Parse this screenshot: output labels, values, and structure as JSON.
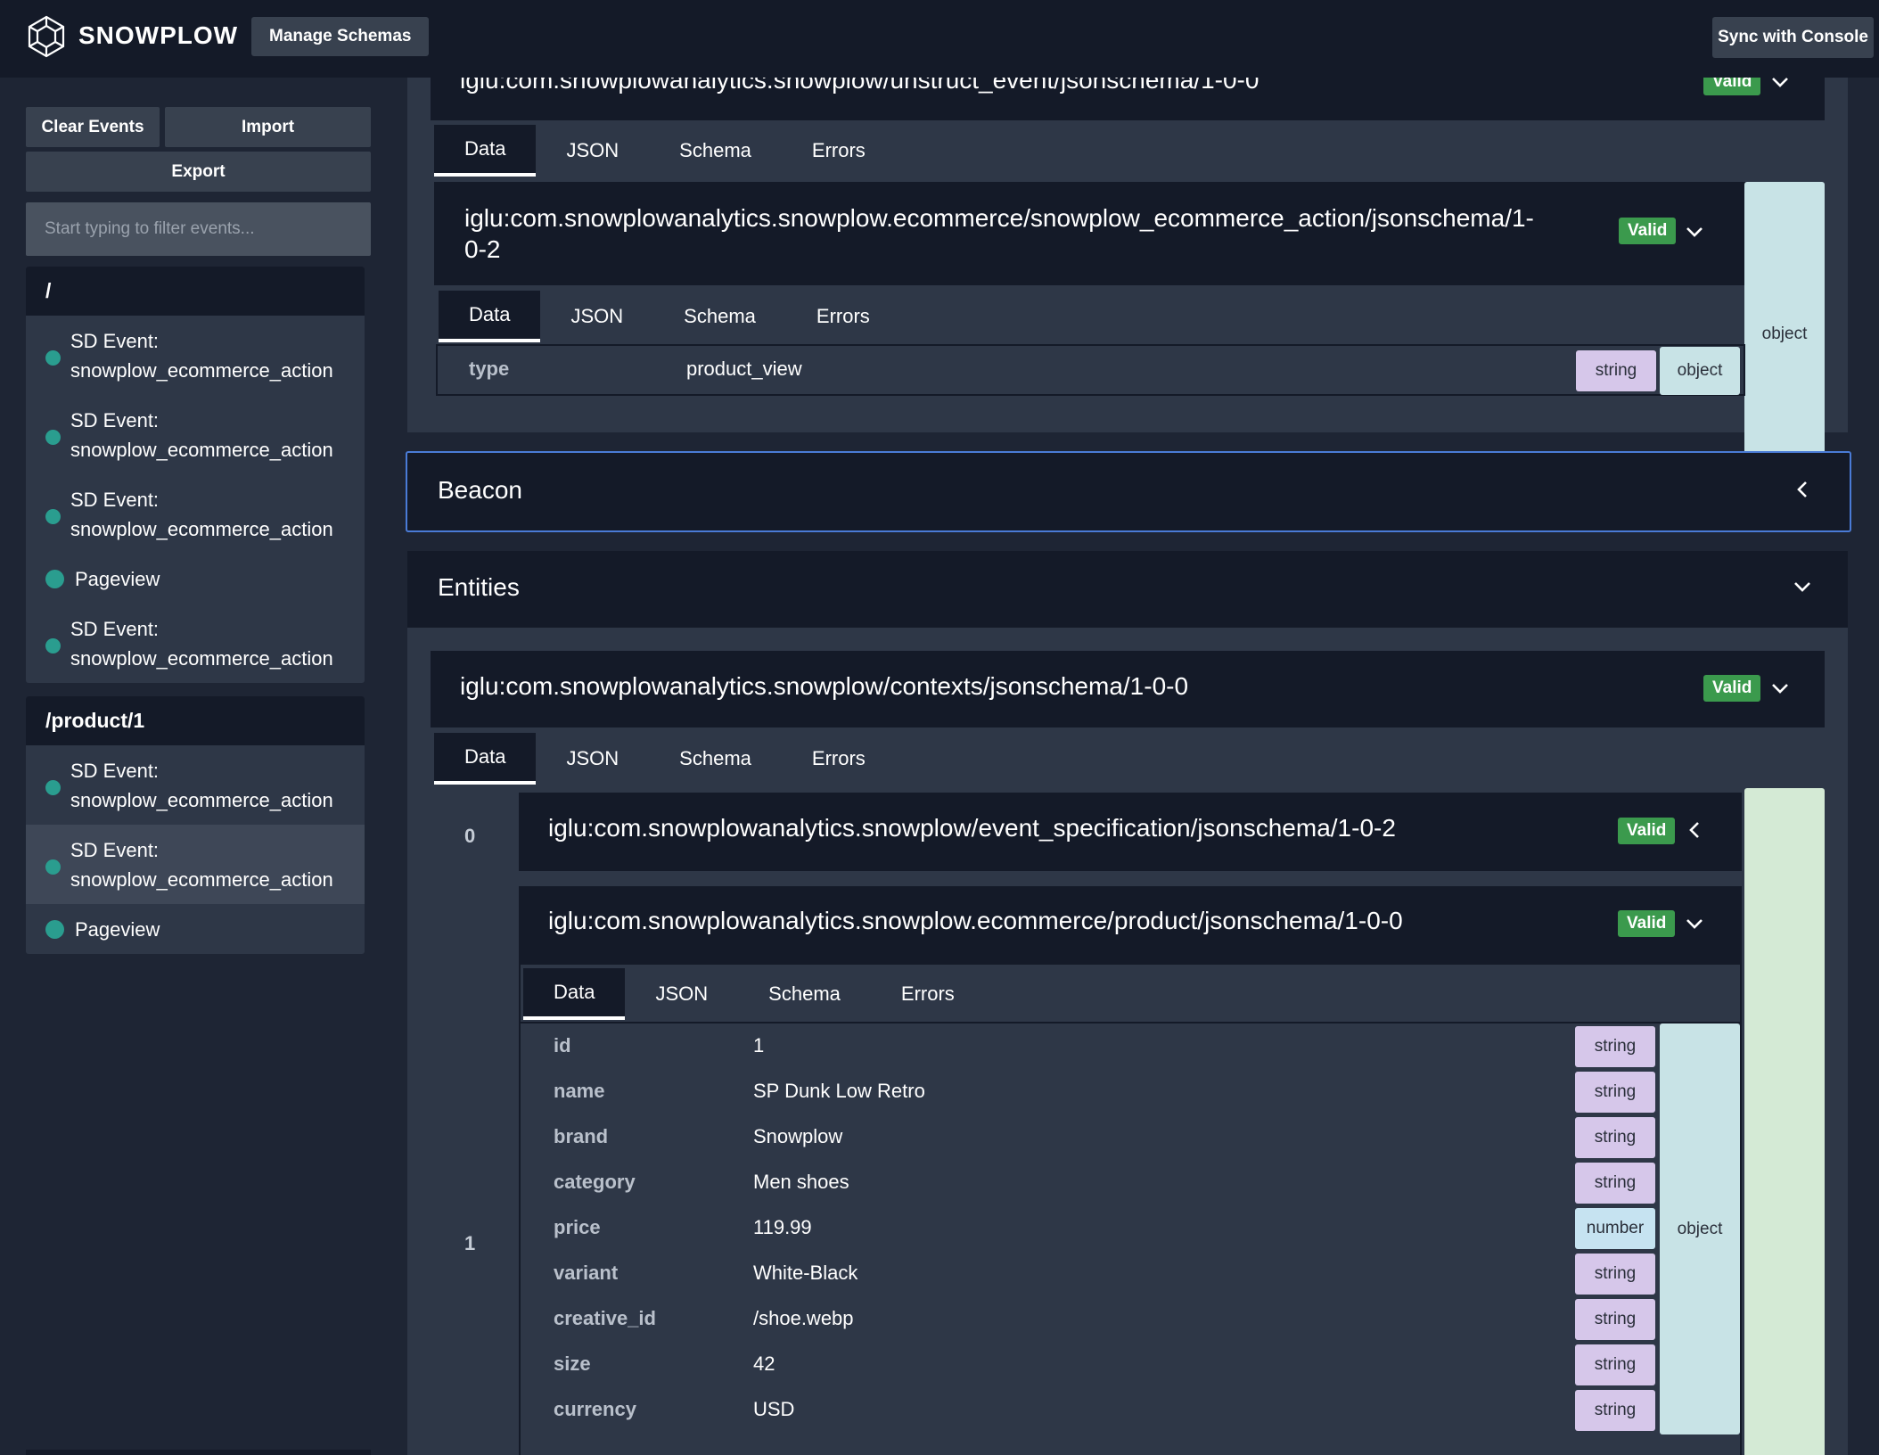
{
  "header": {
    "brand": "SNOWPLOW",
    "manage_label": "Manage Schemas",
    "sync_label": "Sync with Console"
  },
  "sidebar": {
    "clear_label": "Clear Events",
    "import_label": "Import",
    "export_label": "Export",
    "filter_placeholder": "Start typing to filter events...",
    "groups": [
      {
        "path": "/",
        "events": [
          {
            "line1": "SD Event:",
            "line2": "snowplow_ecommerce_action"
          },
          {
            "line1": "SD Event:",
            "line2": "snowplow_ecommerce_action"
          },
          {
            "line1": "SD Event:",
            "line2": "snowplow_ecommerce_action"
          },
          {
            "line1": "Pageview"
          },
          {
            "line1": "SD Event:",
            "line2": "snowplow_ecommerce_action"
          }
        ]
      },
      {
        "path": "/product/1",
        "events": [
          {
            "line1": "SD Event:",
            "line2": "snowplow_ecommerce_action"
          },
          {
            "line1": "SD Event:",
            "line2": "snowplow_ecommerce_action"
          },
          {
            "line1": "Pageview"
          }
        ]
      }
    ]
  },
  "tabs": [
    "Data",
    "JSON",
    "Schema",
    "Errors"
  ],
  "valid_label": "Valid",
  "unstruct": {
    "uri": "iglu:com.snowplowanalytics.snowplow/unstruct_event/jsonschema/1-0-0",
    "inner_uri_line1": "iglu:com.snowplowanalytics.snowplow.ecommerce/snowplow_ecommerce_action/jsonschema/1-",
    "inner_uri_line2": "0-2",
    "row_key": "type",
    "row_val": "product_view",
    "row_type": "string",
    "object_label": "object"
  },
  "beacon_title": "Beacon",
  "entities": {
    "title": "Entities",
    "uri": "iglu:com.snowplowanalytics.snowplow/contexts/jsonschema/1-0-0",
    "index0": "0",
    "index1": "1",
    "entity0_uri": "iglu:com.snowplowanalytics.snowplow/event_specification/jsonschema/1-0-2",
    "entity1_uri": "iglu:com.snowplowanalytics.snowplow.ecommerce/product/jsonschema/1-0-0",
    "object_label": "object",
    "rows": [
      {
        "key": "id",
        "value": "1",
        "type": "string"
      },
      {
        "key": "name",
        "value": "SP Dunk Low Retro",
        "type": "string"
      },
      {
        "key": "brand",
        "value": "Snowplow",
        "type": "string"
      },
      {
        "key": "category",
        "value": "Men shoes",
        "type": "string"
      },
      {
        "key": "price",
        "value": "119.99",
        "type": "number"
      },
      {
        "key": "variant",
        "value": "White-Black",
        "type": "string"
      },
      {
        "key": "creative_id",
        "value": "/shoe.webp",
        "type": "string"
      },
      {
        "key": "size",
        "value": "42",
        "type": "string"
      },
      {
        "key": "currency",
        "value": "USD",
        "type": "string"
      }
    ]
  }
}
